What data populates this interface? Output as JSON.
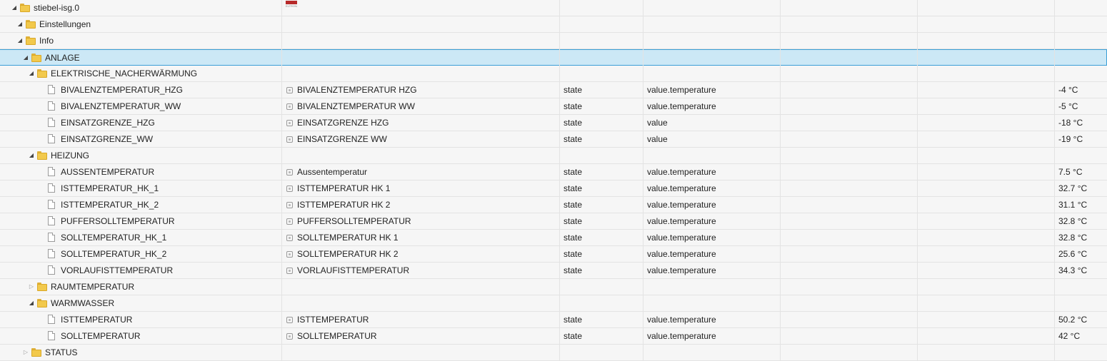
{
  "rows": [
    {
      "level": 0,
      "kind": "folder",
      "toggle": "open",
      "id": "stiebel-isg.0",
      "logo": true,
      "logo_text": "STIEBEL",
      "logo_sub": "ELTRON"
    },
    {
      "level": 1,
      "kind": "folder",
      "toggle": "open",
      "id": "Einstellungen"
    },
    {
      "level": 1,
      "kind": "folder",
      "toggle": "open",
      "id": "Info"
    },
    {
      "level": 2,
      "kind": "folder",
      "toggle": "open",
      "id": "ANLAGE",
      "selected": true
    },
    {
      "level": 3,
      "kind": "folder",
      "toggle": "open",
      "id": "ELEKTRISCHE_NACHERWÄRMUNG"
    },
    {
      "level": 4,
      "kind": "state",
      "id": "BIVALENZTEMPERATUR_HZG",
      "name": "BIVALENZTEMPERATUR HZG",
      "type": "state",
      "role": "value.temperature",
      "value": "-4 °C"
    },
    {
      "level": 4,
      "kind": "state",
      "id": "BIVALENZTEMPERATUR_WW",
      "name": "BIVALENZTEMPERATUR WW",
      "type": "state",
      "role": "value.temperature",
      "value": "-5 °C"
    },
    {
      "level": 4,
      "kind": "state",
      "id": "EINSATZGRENZE_HZG",
      "name": "EINSATZGRENZE HZG",
      "type": "state",
      "role": "value",
      "value": "-18 °C"
    },
    {
      "level": 4,
      "kind": "state",
      "id": "EINSATZGRENZE_WW",
      "name": "EINSATZGRENZE WW",
      "type": "state",
      "role": "value",
      "value": "-19 °C"
    },
    {
      "level": 3,
      "kind": "folder",
      "toggle": "open",
      "id": "HEIZUNG"
    },
    {
      "level": 4,
      "kind": "state",
      "id": "AUSSENTEMPERATUR",
      "name": "Aussentemperatur",
      "type": "state",
      "role": "value.temperature",
      "value": "7.5 °C"
    },
    {
      "level": 4,
      "kind": "state",
      "id": "ISTTEMPERATUR_HK_1",
      "name": "ISTTEMPERATUR HK 1",
      "type": "state",
      "role": "value.temperature",
      "value": "32.7 °C"
    },
    {
      "level": 4,
      "kind": "state",
      "id": "ISTTEMPERATUR_HK_2",
      "name": "ISTTEMPERATUR HK 2",
      "type": "state",
      "role": "value.temperature",
      "value": "31.1 °C"
    },
    {
      "level": 4,
      "kind": "state",
      "id": "PUFFERSOLLTEMPERATUR",
      "name": "PUFFERSOLLTEMPERATUR",
      "type": "state",
      "role": "value.temperature",
      "value": "32.8 °C"
    },
    {
      "level": 4,
      "kind": "state",
      "id": "SOLLTEMPERATUR_HK_1",
      "name": "SOLLTEMPERATUR HK 1",
      "type": "state",
      "role": "value.temperature",
      "value": "32.8 °C"
    },
    {
      "level": 4,
      "kind": "state",
      "id": "SOLLTEMPERATUR_HK_2",
      "name": "SOLLTEMPERATUR HK 2",
      "type": "state",
      "role": "value.temperature",
      "value": "25.6 °C"
    },
    {
      "level": 4,
      "kind": "state",
      "id": "VORLAUFISTTEMPERATUR",
      "name": "VORLAUFISTTEMPERATUR",
      "type": "state",
      "role": "value.temperature",
      "value": "34.3 °C"
    },
    {
      "level": 3,
      "kind": "folder",
      "toggle": "closed",
      "id": "RAUMTEMPERATUR"
    },
    {
      "level": 3,
      "kind": "folder",
      "toggle": "open",
      "id": "WARMWASSER"
    },
    {
      "level": 4,
      "kind": "state",
      "id": "ISTTEMPERATUR",
      "name": "ISTTEMPERATUR",
      "type": "state",
      "role": "value.temperature",
      "value": "50.2 °C"
    },
    {
      "level": 4,
      "kind": "state",
      "id": "SOLLTEMPERATUR",
      "name": "SOLLTEMPERATUR",
      "type": "state",
      "role": "value.temperature",
      "value": "42 °C"
    },
    {
      "level": 2,
      "kind": "folder",
      "toggle": "closed",
      "id": "STATUS"
    }
  ],
  "icons": {
    "open": "triangle-down-icon",
    "closed": "triangle-right-icon",
    "folder": "folder-icon",
    "file": "file-icon",
    "state": "state-icon"
  },
  "colors": {
    "selection": "#cce8f6",
    "selection_border": "#3c9fd6",
    "folder": "#f2c94c"
  }
}
